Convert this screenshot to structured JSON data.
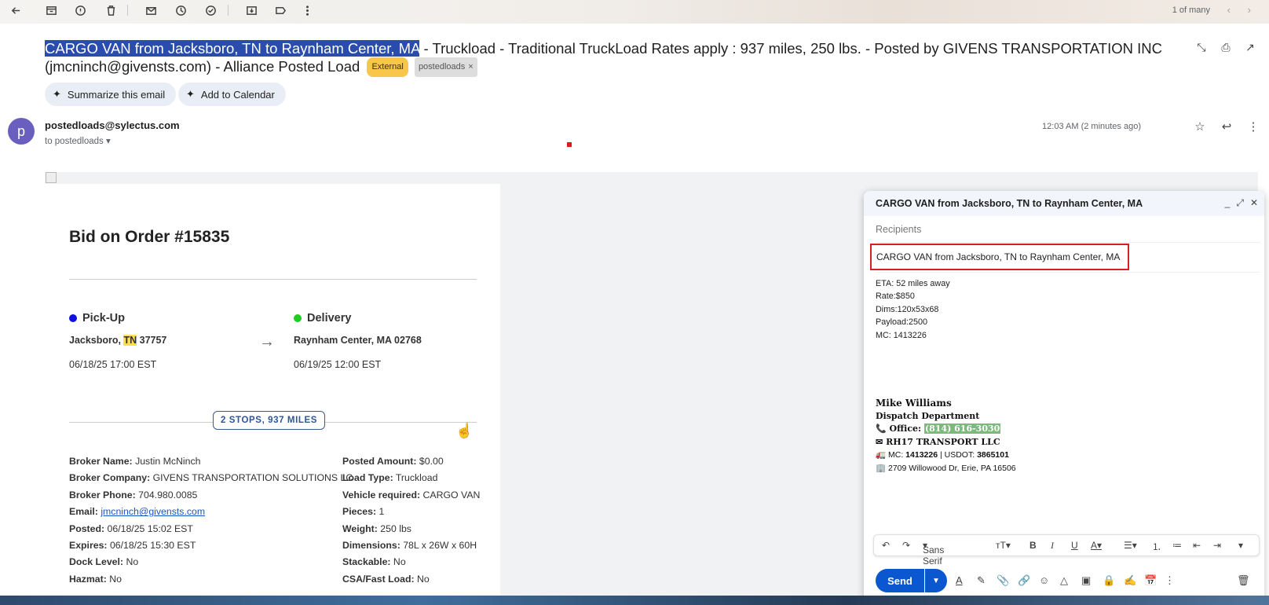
{
  "toolbar": {
    "pager": "1 of many",
    "icons": [
      "back-arrow-icon",
      "archive-icon",
      "report-spam-icon",
      "delete-icon",
      "mark-unread-icon",
      "snooze-icon",
      "add-task-icon",
      "move-to-icon",
      "label-icon",
      "more-vertical-icon"
    ]
  },
  "subject": {
    "highlighted": "CARGO VAN from Jacksboro, TN to Raynham Center, MA",
    "rest": " - Truckload - Traditional TruckLoad Rates apply : 937 miles, 250 lbs. - Posted by GIVENS TRANSPORTATION INC (jmcninch@givensts.com) - Alliance Posted Load",
    "external_badge": "External",
    "label_badge": "postedloads"
  },
  "chips": {
    "summarize": "Summarize this email",
    "calendar": "Add to Calendar"
  },
  "sender": {
    "avatar_letter": "p",
    "email": "postedloads@sylectus.com",
    "to": "to postedloads",
    "time": "12:03 AM (2 minutes ago)"
  },
  "order": {
    "title": "Bid on Order #15835",
    "pickup_label": "Pick-Up",
    "pickup_city": "Jacksboro, ",
    "pickup_state": "TN",
    "pickup_zip": " 37757",
    "pickup_date": "06/18/25 17:00 EST",
    "delivery_label": "Delivery",
    "delivery_addr": "Raynham Center, MA 02768",
    "delivery_date": "06/19/25 12:00 EST",
    "stops": "2 STOPS, 937 MILES",
    "colors": {
      "pickup": "#1010e0",
      "delivery": "#22cc22"
    }
  },
  "details_left": [
    {
      "k": "Broker Name:",
      "v": " Justin McNinch"
    },
    {
      "k": "Broker Company:",
      "v": " GIVENS TRANSPORTATION SOLUTIONS LC"
    },
    {
      "k": "Broker Phone:",
      "v": " 704.980.0085"
    },
    {
      "k": "Email:",
      "v": "jmcninch@givensts.com"
    },
    {
      "k": "Posted:",
      "v": " 06/18/25 15:02 EST"
    },
    {
      "k": "Expires:",
      "v": " 06/18/25 15:30 EST"
    },
    {
      "k": "Dock Level:",
      "v": " No"
    },
    {
      "k": "Hazmat:",
      "v": " No"
    }
  ],
  "details_right": [
    {
      "k": "Posted Amount:",
      "v": " $0.00"
    },
    {
      "k": "Load Type:",
      "v": " Truckload"
    },
    {
      "k": "Vehicle required:",
      "v": " CARGO VAN"
    },
    {
      "k": "Pieces:",
      "v": " 1"
    },
    {
      "k": "Weight:",
      "v": " 250 lbs"
    },
    {
      "k": "Dimensions:",
      "v": " 78L x 26W x 60H"
    },
    {
      "k": "Stackable:",
      "v": " No"
    },
    {
      "k": "CSA/Fast Load:",
      "v": " No"
    }
  ],
  "compose": {
    "title": "CARGO VAN from Jacksboro, TN to Raynham Center, MA",
    "recipients_placeholder": "Recipients",
    "subject": "CARGO VAN from Jacksboro, TN to Raynham Center, MA",
    "body": [
      "ETA: 52 miles away",
      "Rate:$850",
      "Dims:120x53x68",
      "Payload:2500",
      "MC: 1413226"
    ],
    "sig_name": "Mike Williams",
    "sig_dept": "Dispatch Department",
    "sig_office_label": "Office:",
    "sig_phone": "(814) 616-3030",
    "sig_company": "RH17 TRANSPORT LLC",
    "sig_mc_label": "MC:",
    "sig_mc": "1413226",
    "sig_usdot_label": " | USDOT:",
    "sig_usdot": "3865101",
    "sig_address": "2709 Willowood Dr, Erie, PA 16506",
    "font": "Sans Serif",
    "send": "Send"
  }
}
